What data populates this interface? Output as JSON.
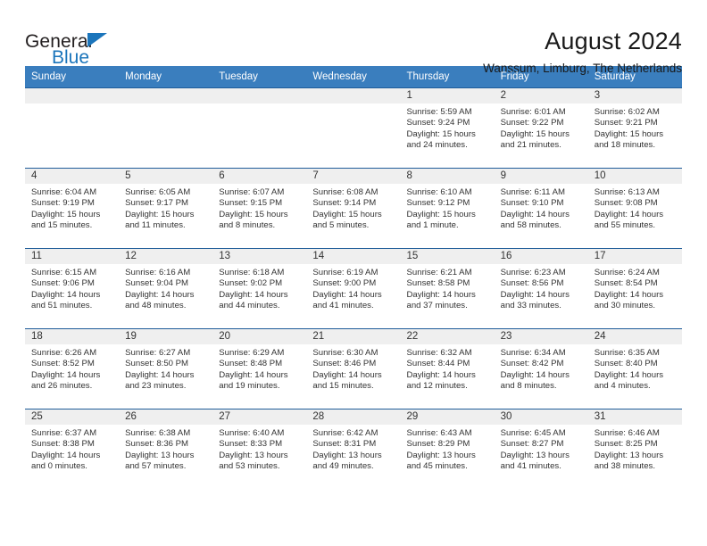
{
  "brand": {
    "name_dark": "General",
    "name_blue": "Blue",
    "accent_color": "#1b75bb"
  },
  "header": {
    "title": "August 2024",
    "location": "Wanssum, Limburg, The Netherlands"
  },
  "theme": {
    "header_row_bg": "#3a7ebe",
    "week_divider": "#1f5c99",
    "date_strip_bg": "#efefef",
    "text_color": "#333333"
  },
  "calendar": {
    "day_headers": [
      "Sunday",
      "Monday",
      "Tuesday",
      "Wednesday",
      "Thursday",
      "Friday",
      "Saturday"
    ],
    "labels": {
      "sunrise": "Sunrise:",
      "sunset": "Sunset:",
      "daylight": "Daylight:"
    },
    "weeks": [
      [
        {
          "day": ""
        },
        {
          "day": ""
        },
        {
          "day": ""
        },
        {
          "day": ""
        },
        {
          "day": "1",
          "sunrise": "Sunrise: 5:59 AM",
          "sunset": "Sunset: 9:24 PM",
          "daylight_1": "Daylight: 15 hours",
          "daylight_2": "and 24 minutes."
        },
        {
          "day": "2",
          "sunrise": "Sunrise: 6:01 AM",
          "sunset": "Sunset: 9:22 PM",
          "daylight_1": "Daylight: 15 hours",
          "daylight_2": "and 21 minutes."
        },
        {
          "day": "3",
          "sunrise": "Sunrise: 6:02 AM",
          "sunset": "Sunset: 9:21 PM",
          "daylight_1": "Daylight: 15 hours",
          "daylight_2": "and 18 minutes."
        }
      ],
      [
        {
          "day": "4",
          "sunrise": "Sunrise: 6:04 AM",
          "sunset": "Sunset: 9:19 PM",
          "daylight_1": "Daylight: 15 hours",
          "daylight_2": "and 15 minutes."
        },
        {
          "day": "5",
          "sunrise": "Sunrise: 6:05 AM",
          "sunset": "Sunset: 9:17 PM",
          "daylight_1": "Daylight: 15 hours",
          "daylight_2": "and 11 minutes."
        },
        {
          "day": "6",
          "sunrise": "Sunrise: 6:07 AM",
          "sunset": "Sunset: 9:15 PM",
          "daylight_1": "Daylight: 15 hours",
          "daylight_2": "and 8 minutes."
        },
        {
          "day": "7",
          "sunrise": "Sunrise: 6:08 AM",
          "sunset": "Sunset: 9:14 PM",
          "daylight_1": "Daylight: 15 hours",
          "daylight_2": "and 5 minutes."
        },
        {
          "day": "8",
          "sunrise": "Sunrise: 6:10 AM",
          "sunset": "Sunset: 9:12 PM",
          "daylight_1": "Daylight: 15 hours",
          "daylight_2": "and 1 minute."
        },
        {
          "day": "9",
          "sunrise": "Sunrise: 6:11 AM",
          "sunset": "Sunset: 9:10 PM",
          "daylight_1": "Daylight: 14 hours",
          "daylight_2": "and 58 minutes."
        },
        {
          "day": "10",
          "sunrise": "Sunrise: 6:13 AM",
          "sunset": "Sunset: 9:08 PM",
          "daylight_1": "Daylight: 14 hours",
          "daylight_2": "and 55 minutes."
        }
      ],
      [
        {
          "day": "11",
          "sunrise": "Sunrise: 6:15 AM",
          "sunset": "Sunset: 9:06 PM",
          "daylight_1": "Daylight: 14 hours",
          "daylight_2": "and 51 minutes."
        },
        {
          "day": "12",
          "sunrise": "Sunrise: 6:16 AM",
          "sunset": "Sunset: 9:04 PM",
          "daylight_1": "Daylight: 14 hours",
          "daylight_2": "and 48 minutes."
        },
        {
          "day": "13",
          "sunrise": "Sunrise: 6:18 AM",
          "sunset": "Sunset: 9:02 PM",
          "daylight_1": "Daylight: 14 hours",
          "daylight_2": "and 44 minutes."
        },
        {
          "day": "14",
          "sunrise": "Sunrise: 6:19 AM",
          "sunset": "Sunset: 9:00 PM",
          "daylight_1": "Daylight: 14 hours",
          "daylight_2": "and 41 minutes."
        },
        {
          "day": "15",
          "sunrise": "Sunrise: 6:21 AM",
          "sunset": "Sunset: 8:58 PM",
          "daylight_1": "Daylight: 14 hours",
          "daylight_2": "and 37 minutes."
        },
        {
          "day": "16",
          "sunrise": "Sunrise: 6:23 AM",
          "sunset": "Sunset: 8:56 PM",
          "daylight_1": "Daylight: 14 hours",
          "daylight_2": "and 33 minutes."
        },
        {
          "day": "17",
          "sunrise": "Sunrise: 6:24 AM",
          "sunset": "Sunset: 8:54 PM",
          "daylight_1": "Daylight: 14 hours",
          "daylight_2": "and 30 minutes."
        }
      ],
      [
        {
          "day": "18",
          "sunrise": "Sunrise: 6:26 AM",
          "sunset": "Sunset: 8:52 PM",
          "daylight_1": "Daylight: 14 hours",
          "daylight_2": "and 26 minutes."
        },
        {
          "day": "19",
          "sunrise": "Sunrise: 6:27 AM",
          "sunset": "Sunset: 8:50 PM",
          "daylight_1": "Daylight: 14 hours",
          "daylight_2": "and 23 minutes."
        },
        {
          "day": "20",
          "sunrise": "Sunrise: 6:29 AM",
          "sunset": "Sunset: 8:48 PM",
          "daylight_1": "Daylight: 14 hours",
          "daylight_2": "and 19 minutes."
        },
        {
          "day": "21",
          "sunrise": "Sunrise: 6:30 AM",
          "sunset": "Sunset: 8:46 PM",
          "daylight_1": "Daylight: 14 hours",
          "daylight_2": "and 15 minutes."
        },
        {
          "day": "22",
          "sunrise": "Sunrise: 6:32 AM",
          "sunset": "Sunset: 8:44 PM",
          "daylight_1": "Daylight: 14 hours",
          "daylight_2": "and 12 minutes."
        },
        {
          "day": "23",
          "sunrise": "Sunrise: 6:34 AM",
          "sunset": "Sunset: 8:42 PM",
          "daylight_1": "Daylight: 14 hours",
          "daylight_2": "and 8 minutes."
        },
        {
          "day": "24",
          "sunrise": "Sunrise: 6:35 AM",
          "sunset": "Sunset: 8:40 PM",
          "daylight_1": "Daylight: 14 hours",
          "daylight_2": "and 4 minutes."
        }
      ],
      [
        {
          "day": "25",
          "sunrise": "Sunrise: 6:37 AM",
          "sunset": "Sunset: 8:38 PM",
          "daylight_1": "Daylight: 14 hours",
          "daylight_2": "and 0 minutes."
        },
        {
          "day": "26",
          "sunrise": "Sunrise: 6:38 AM",
          "sunset": "Sunset: 8:36 PM",
          "daylight_1": "Daylight: 13 hours",
          "daylight_2": "and 57 minutes."
        },
        {
          "day": "27",
          "sunrise": "Sunrise: 6:40 AM",
          "sunset": "Sunset: 8:33 PM",
          "daylight_1": "Daylight: 13 hours",
          "daylight_2": "and 53 minutes."
        },
        {
          "day": "28",
          "sunrise": "Sunrise: 6:42 AM",
          "sunset": "Sunset: 8:31 PM",
          "daylight_1": "Daylight: 13 hours",
          "daylight_2": "and 49 minutes."
        },
        {
          "day": "29",
          "sunrise": "Sunrise: 6:43 AM",
          "sunset": "Sunset: 8:29 PM",
          "daylight_1": "Daylight: 13 hours",
          "daylight_2": "and 45 minutes."
        },
        {
          "day": "30",
          "sunrise": "Sunrise: 6:45 AM",
          "sunset": "Sunset: 8:27 PM",
          "daylight_1": "Daylight: 13 hours",
          "daylight_2": "and 41 minutes."
        },
        {
          "day": "31",
          "sunrise": "Sunrise: 6:46 AM",
          "sunset": "Sunset: 8:25 PM",
          "daylight_1": "Daylight: 13 hours",
          "daylight_2": "and 38 minutes."
        }
      ]
    ]
  }
}
